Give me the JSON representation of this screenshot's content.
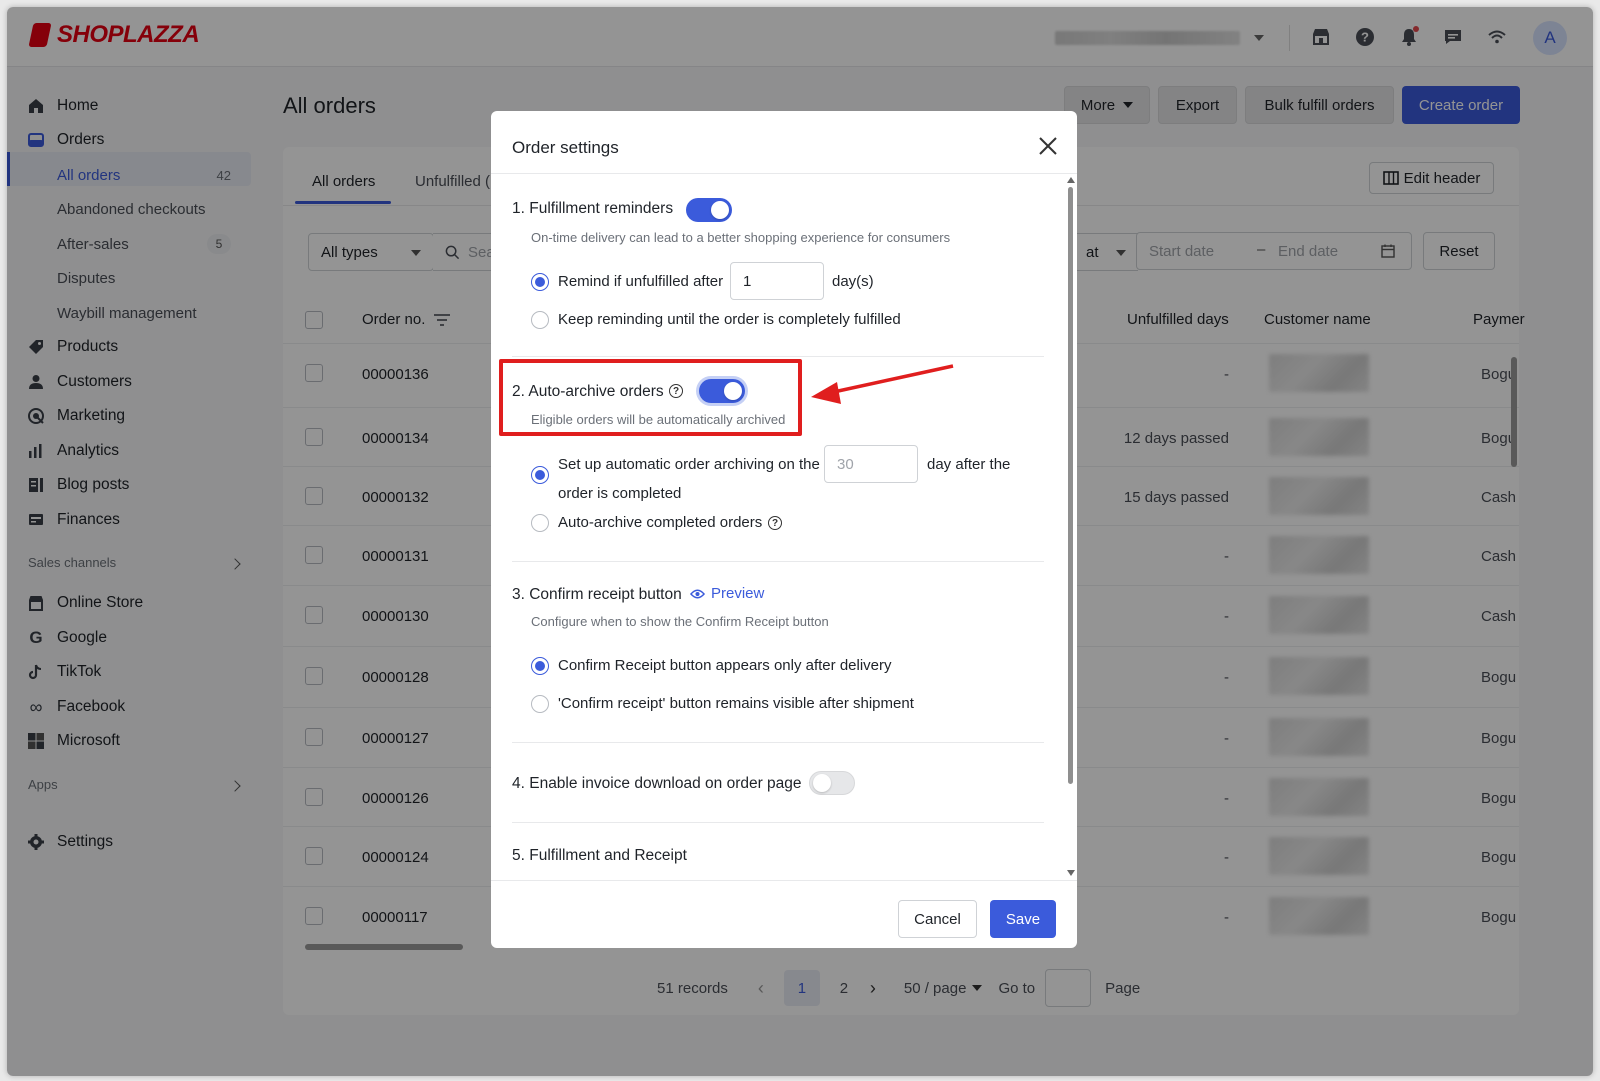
{
  "brand": {
    "name": "SHOPLAZZA",
    "color": "#e60012"
  },
  "accent_color": "#3b5bdb",
  "topbar": {
    "icons": [
      "store-icon",
      "help-icon",
      "bell-icon",
      "message-icon",
      "wifi-icon"
    ],
    "avatar_initial": "A"
  },
  "sidebar": {
    "home": "Home",
    "orders": "Orders",
    "all_orders": "All orders",
    "all_orders_count": "42",
    "abandoned": "Abandoned checkouts",
    "after_sales": "After-sales",
    "after_sales_count": "5",
    "disputes": "Disputes",
    "waybill": "Waybill management",
    "products": "Products",
    "customers": "Customers",
    "marketing": "Marketing",
    "analytics": "Analytics",
    "blog_posts": "Blog posts",
    "finances": "Finances",
    "sales_channels": "Sales channels",
    "online_store": "Online Store",
    "google": "Google",
    "tiktok": "TikTok",
    "facebook": "Facebook",
    "microsoft": "Microsoft",
    "apps": "Apps",
    "settings": "Settings"
  },
  "main": {
    "title": "All orders",
    "more": "More",
    "export": "Export",
    "bulk_fulfill": "Bulk fulfill orders",
    "create_order": "Create order",
    "tab_all": "All orders",
    "tab_unfulfilled": "Unfulfilled (",
    "edit_header": "Edit header",
    "filter_type": "All types",
    "search_placeholder": "Sea",
    "date_field": "at",
    "start_date": "Start date",
    "end_date": "End date",
    "reset": "Reset",
    "columns": {
      "order_no": "Order no.",
      "unfulfilled_days": "Unfulfilled days",
      "customer_name": "Customer name",
      "payment": "Paymer"
    },
    "rows": [
      {
        "order": "00000136",
        "days": "-",
        "payment": "Bogu"
      },
      {
        "order": "00000134",
        "days": "12 days passed",
        "payment": "Bogu"
      },
      {
        "order": "00000132",
        "days": "15 days passed",
        "payment": "Cash"
      },
      {
        "order": "00000131",
        "days": "-",
        "payment": "Cash"
      },
      {
        "order": "00000130",
        "days": "-",
        "payment": "Cash"
      },
      {
        "order": "00000128",
        "days": "-",
        "payment": "Bogu"
      },
      {
        "order": "00000127",
        "days": "-",
        "payment": "Bogu"
      },
      {
        "order": "00000126",
        "days": "-",
        "payment": "Bogu"
      },
      {
        "order": "00000124",
        "days": "-",
        "payment": "Bogu"
      },
      {
        "order": "00000117",
        "days": "-",
        "payment": "Bogu"
      }
    ],
    "pagination": {
      "records": "51 records",
      "page1": "1",
      "page2": "2",
      "page_size": "50 / page",
      "goto": "Go to",
      "page_label": "Page"
    }
  },
  "modal": {
    "title": "Order settings",
    "s1_title": "1. Fulfillment reminders",
    "s1_desc": "On-time delivery can lead to a better shopping experience for consumers",
    "s1_opt1_pre": "Remind if unfulfilled after",
    "s1_opt1_value": "1",
    "s1_opt1_post": "day(s)",
    "s1_opt2": "Keep reminding until the order is completely fulfilled",
    "s2_title": "2. Auto-archive orders",
    "s2_desc": "Eligible orders will be automatically archived",
    "s2_opt1_pre": "Set up automatic order archiving on the",
    "s2_opt1_value": "30",
    "s2_opt1_post": "day after the",
    "s2_opt1_line2": "order is completed",
    "s2_opt2": "Auto-archive completed orders",
    "s3_title": "3. Confirm receipt button",
    "s3_preview": "Preview",
    "s3_desc": "Configure when to show the Confirm Receipt button",
    "s3_opt1": "Confirm Receipt button appears only after delivery",
    "s3_opt2": "'Confirm receipt' button remains visible after shipment",
    "s4_title": "4. Enable invoice download on order page",
    "s5_title": "5. Fulfillment and Receipt",
    "cancel": "Cancel",
    "save": "Save"
  },
  "annotation_color": "#e01e1e"
}
